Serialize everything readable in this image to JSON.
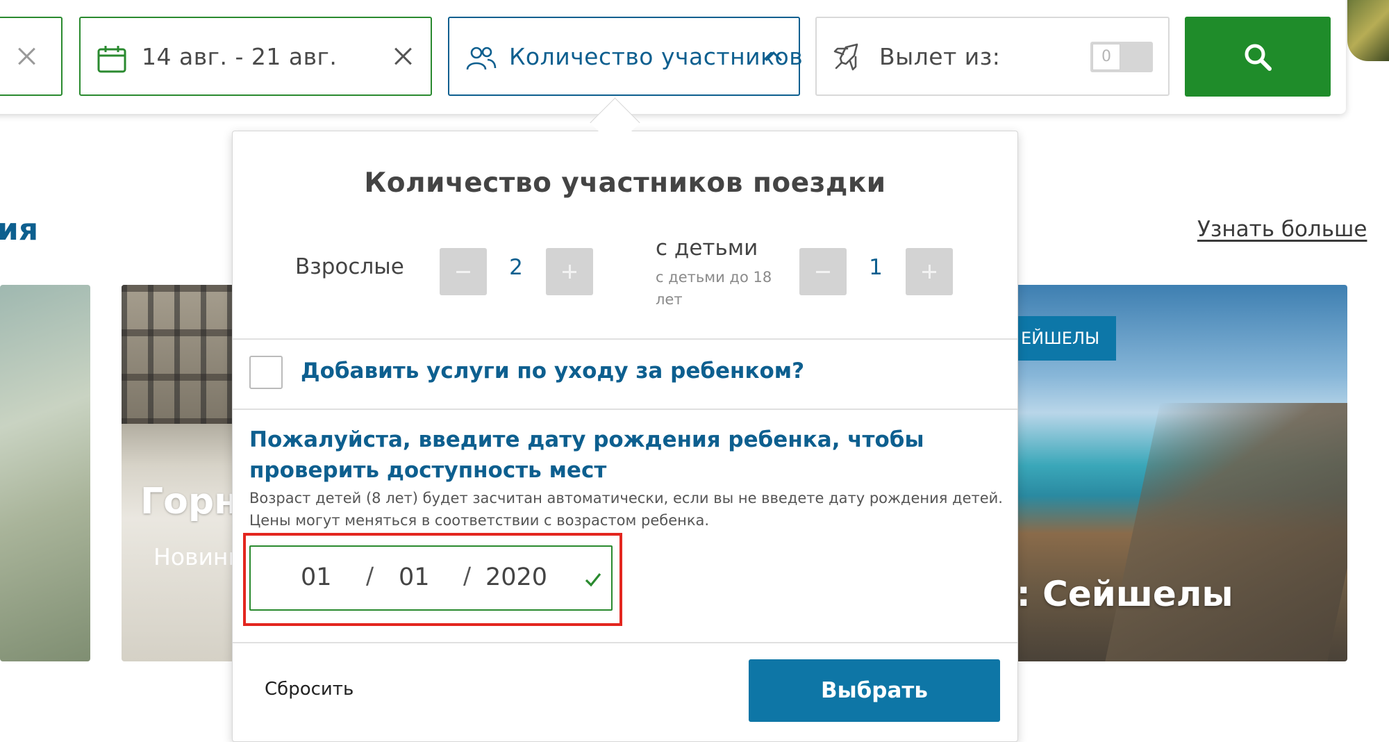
{
  "search_bar": {
    "date_range": "14 авг. - 21 авг.",
    "participants_label": "Количество участников",
    "departure_label": "Вылет из:",
    "departure_toggle_value": "0"
  },
  "background": {
    "section_title_fragment": "ия",
    "learn_more": "Узнать больше",
    "card_mountain": {
      "title": "Горно",
      "subtitle": "Новинк"
    },
    "card_seychelles": {
      "tag": "ЕЙШЕЛЫ",
      "title": "а: Сейшелы"
    }
  },
  "popover": {
    "title": "Количество участников поездки",
    "adults": {
      "label": "Взрослые",
      "value": "2"
    },
    "children": {
      "label": "с детьми",
      "sublabel": "с детьми до 18 лет",
      "value": "1"
    },
    "childcare_label": "Добавить услуги по уходу за ребенком?",
    "childcare_checked": false,
    "dob_heading": "Пожалуйста, введите дату рождения ребенка, чтобы проверить доступность мест",
    "dob_note": "Возраст детей (8 лет) будет засчитан автоматически, если вы не введете дату рождения детей. Цены могут меняться в соответствии с возрастом ребенка.",
    "dob": {
      "day": "01",
      "month": "01",
      "year": "2020",
      "separator": "/"
    },
    "reset_label": "Сбросить",
    "choose_label": "Выбрать"
  },
  "colors": {
    "brand_green": "#1f8c2a",
    "brand_blue": "#0d5f8f",
    "button_blue": "#0e76a6",
    "highlight_red": "#e3261f"
  }
}
